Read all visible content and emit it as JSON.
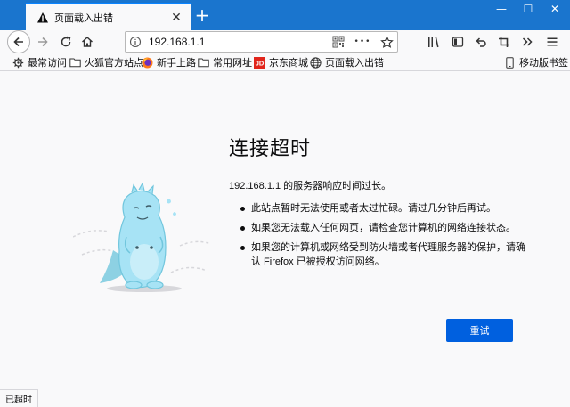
{
  "tab": {
    "title": "页面载入出错",
    "close_glyph": "✕"
  },
  "newtab_glyph": "+",
  "window_controls": {
    "minimize": "—",
    "maximize": "☐",
    "close": "✕"
  },
  "urlbar": {
    "url": "192.168.1.1",
    "more_glyph": "•••"
  },
  "bookmarks": [
    {
      "label": "最常访问",
      "icon": "gear-icon"
    },
    {
      "label": "火狐官方站点",
      "icon": "folder-icon"
    },
    {
      "label": "新手上路",
      "icon": "firefox-icon"
    },
    {
      "label": "常用网址",
      "icon": "folder-icon"
    },
    {
      "label": "京东商城",
      "icon": "jd-icon"
    },
    {
      "label": "页面载入出错",
      "icon": "globe-icon"
    }
  ],
  "mobile_bookmarks": "移动版书签",
  "error": {
    "title": "连接超时",
    "description": "192.168.1.1 的服务器响应时间过长。",
    "items": [
      "此站点暂时无法使用或者太过忙碌。请过几分钟后再试。",
      "如果您无法载入任何网页，请检查您计算机的网络连接状态。",
      "如果您的计算机或网络受到防火墙或者代理服务器的保护，请确认 Firefox 已被授权访问网络。"
    ],
    "retry_label": "重试"
  },
  "status_text": "已超时",
  "colors": {
    "tabstrip": "#1a75ce",
    "accent": "#0a84ff",
    "retry": "#0060df",
    "illustration": "#a7e3f5"
  }
}
